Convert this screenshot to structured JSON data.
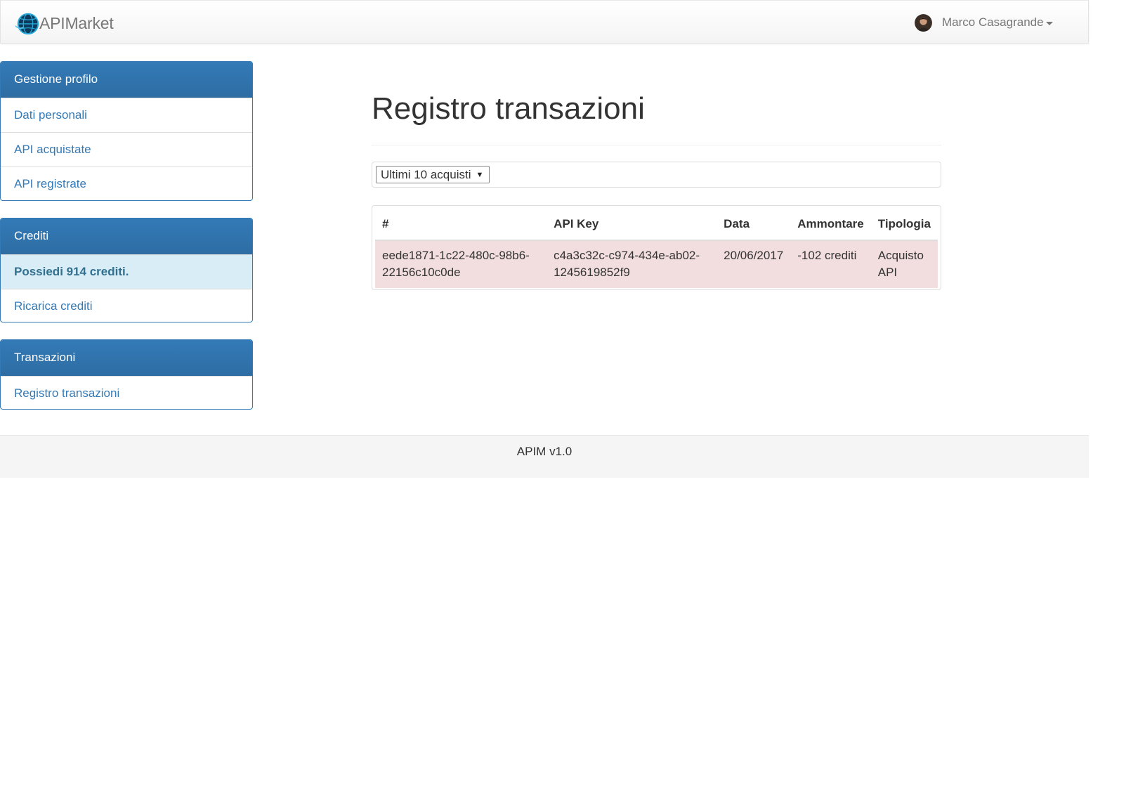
{
  "navbar": {
    "brand": "APIMarket",
    "logo_icon": "globe-logo-icon",
    "user_name": "Marco Casagrande"
  },
  "sidebar": {
    "profile": {
      "heading": "Gestione profilo",
      "items": [
        "Dati personali",
        "API acquistate",
        "API registrate"
      ]
    },
    "credits": {
      "heading": "Crediti",
      "balance": "Possiedi 914 crediti.",
      "recharge": "Ricarica crediti"
    },
    "transactions": {
      "heading": "Transazioni",
      "items": [
        "Registro transazioni"
      ]
    }
  },
  "main": {
    "title": "Registro transazioni",
    "filter": {
      "selected": "Ultimi 10 acquisti"
    },
    "table": {
      "headers": [
        "#",
        "API Key",
        "Data",
        "Ammontare",
        "Tipologia"
      ],
      "rows": [
        [
          "eede1871-1c22-480c-98b6-22156c10c0de",
          "c4a3c32c-c974-434e-ab02-1245619852f9",
          "20/06/2017",
          "-102 crediti",
          "Acquisto API"
        ]
      ]
    }
  },
  "footer": {
    "text": "APIM v1.0"
  },
  "colors": {
    "primary": "#337ab7",
    "info_bg": "#d9edf7",
    "danger_row": "#f2dede"
  }
}
